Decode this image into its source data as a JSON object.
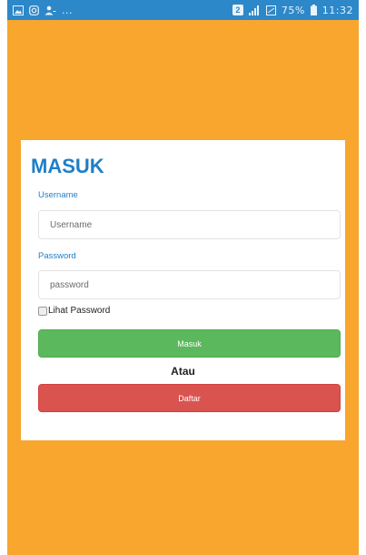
{
  "status_bar": {
    "left_dots": "...",
    "sim_badge": "2",
    "battery_percent": "75%",
    "time": "11:32"
  },
  "login": {
    "title": "MASUK",
    "username_label": "Username",
    "username_placeholder": "Username",
    "username_value": "",
    "password_label": "Password",
    "password_placeholder": "password",
    "password_value": "",
    "show_password_label": "Lihat Password",
    "show_password_checked": false,
    "login_button": "Masuk",
    "or_text": "Atau",
    "register_button": "Daftar"
  },
  "colors": {
    "background": "#f8a62e",
    "status_bar": "#2d88c9",
    "title_blue": "#1f7fc7",
    "login_button": "#5cb85c",
    "register_button": "#d9534f"
  }
}
